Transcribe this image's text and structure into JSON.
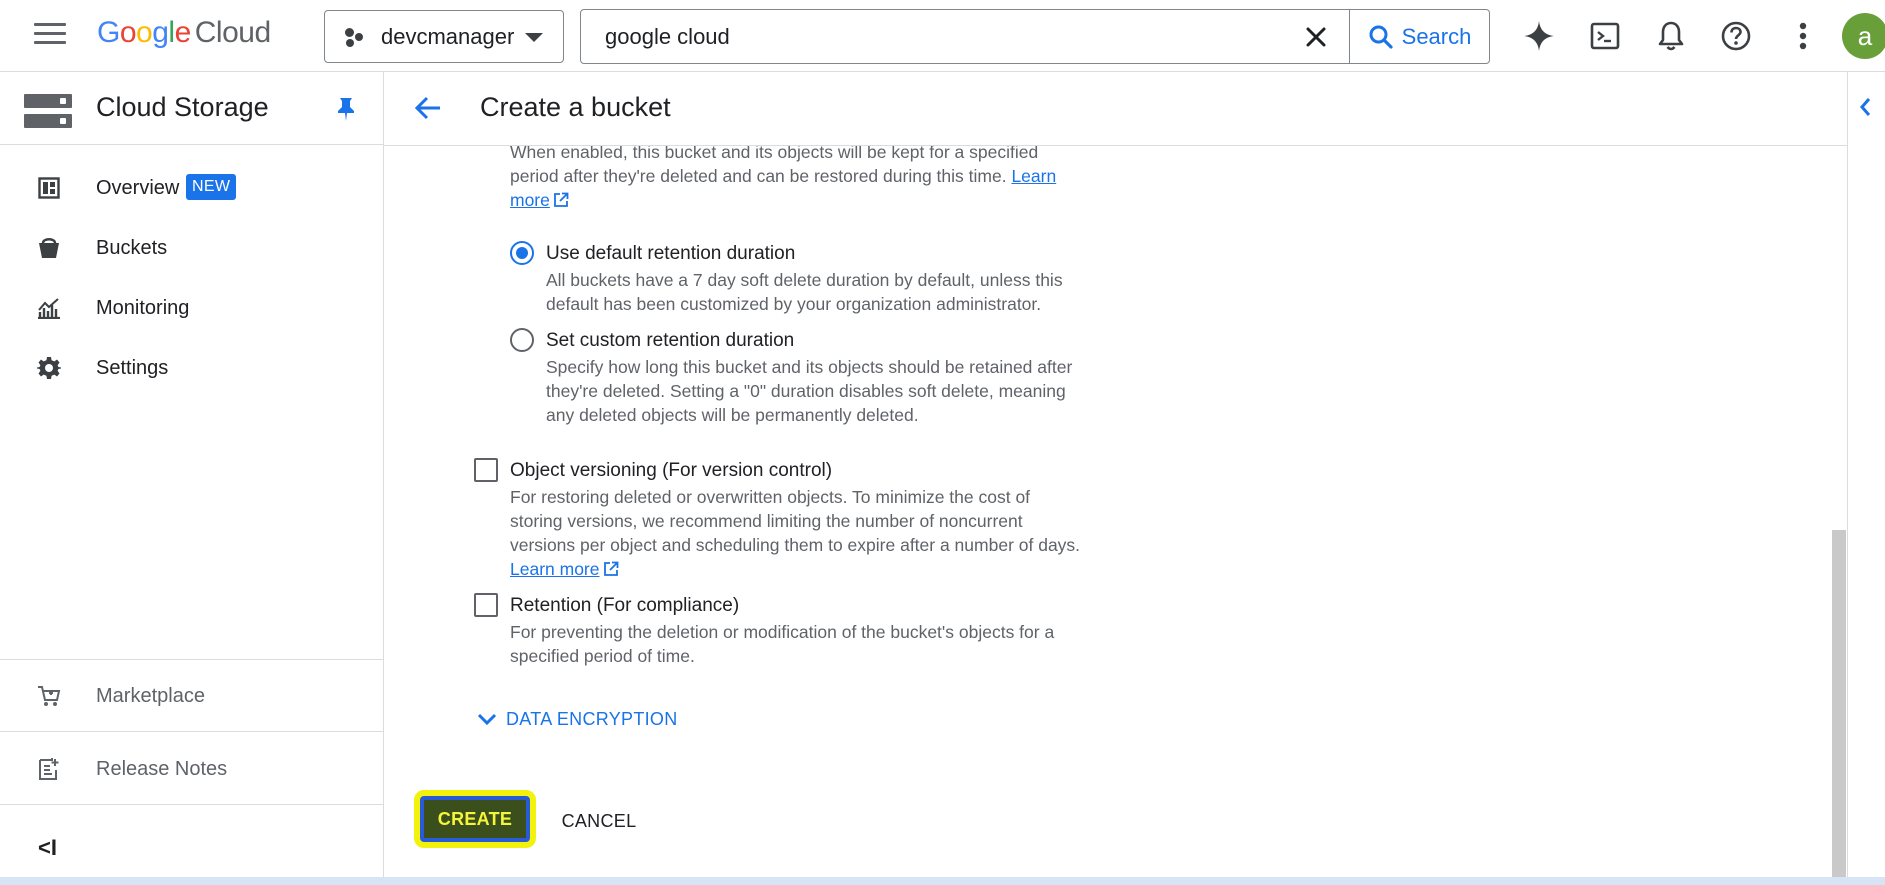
{
  "topbar": {
    "logo_letters": [
      "G",
      "o",
      "o",
      "g",
      "l",
      "e"
    ],
    "logo_product": "Cloud",
    "project_name": "devcmanager",
    "search_value": "google cloud",
    "search_button": "Search",
    "avatar_letter": "a",
    "icons": [
      "menu-icon",
      "sparkle-icon",
      "terminal-icon",
      "bell-icon",
      "help-icon",
      "more-vert-icon"
    ]
  },
  "sidebar": {
    "title": "Cloud Storage",
    "items": [
      {
        "label": "Overview",
        "badge": "NEW",
        "icon": "overview-icon"
      },
      {
        "label": "Buckets",
        "icon": "bucket-icon"
      },
      {
        "label": "Monitoring",
        "icon": "monitoring-icon"
      },
      {
        "label": "Settings",
        "icon": "gear-icon"
      }
    ],
    "footer": [
      {
        "label": "Marketplace",
        "icon": "cart-icon"
      },
      {
        "label": "Release Notes",
        "icon": "notes-icon"
      }
    ],
    "collapse": "<I"
  },
  "main": {
    "title": "Create a bucket",
    "soft_delete_desc_line1": "When enabled, this bucket and its objects will be kept for a specified",
    "soft_delete_desc_line2": "period after they're deleted and can be restored during this time.",
    "learn": "Learn",
    "more": "more",
    "radio_default": {
      "label": "Use default retention duration",
      "line1": "All buckets have a 7 day soft delete duration by default, unless this",
      "line2": "default has been customized by your organization administrator."
    },
    "radio_custom": {
      "label": "Set custom retention duration",
      "line1": "Specify how long this bucket and its objects should be retained after",
      "line2": "they're deleted. Setting a \"0\" duration disables soft delete, meaning",
      "line3": "any deleted objects will be permanently deleted."
    },
    "versioning": {
      "label": "Object versioning (For version control)",
      "line1": "For restoring deleted or overwritten objects. To minimize the cost of",
      "line2": "storing versions, we recommend limiting the number of noncurrent",
      "line3": "versions per object and scheduling them to expire after a number of days.",
      "link": "Learn more"
    },
    "retention": {
      "label": "Retention (For compliance)",
      "line1": "For preventing the deletion or modification of the bucket's objects for a",
      "line2": "specified period of time."
    },
    "data_encryption": "DATA ENCRYPTION",
    "create_label": "CREATE",
    "cancel_label": "CANCEL"
  },
  "colors": {
    "accent": "#1a73e8",
    "highlight": "#f2f20c",
    "create_bg": "#3b4f1c"
  }
}
